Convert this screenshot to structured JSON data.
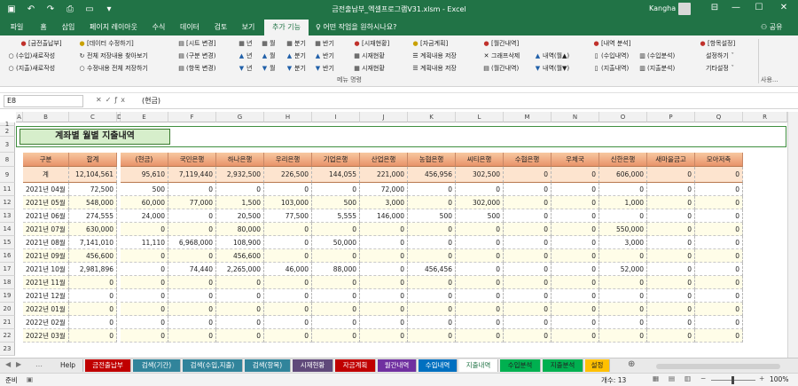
{
  "window": {
    "title": "금전출납부_엑셀프로그램V31.xlsm - Excel",
    "user": "Kangha",
    "qat_icons": [
      "save-icon",
      "undo-icon",
      "redo-icon",
      "print-icon",
      "screenshot-icon",
      "customize-icon"
    ]
  },
  "menu": {
    "tabs": [
      "파일",
      "홈",
      "삽입",
      "페이지 레이아웃",
      "수식",
      "데이터",
      "검토",
      "보기",
      "추가 기능"
    ],
    "active": "추가 기능",
    "tell_me": "어떤 작업을 원하시나요?",
    "share": "공유"
  },
  "ribbon": {
    "row1": [
      "[금전출납부]",
      "[데이터 수정하기]",
      "[시트 변경]",
      "년",
      "월",
      "분기",
      "반기",
      "[시재현황]",
      "[자금계획]",
      "[월간내역]",
      "[내역 분석]",
      "[항목설정]"
    ],
    "row2": [
      "(수입)새로작성",
      "전체 저장내용 찾아보기",
      "(구분 변경)",
      "년",
      "월",
      "분기",
      "반기",
      "시재현황",
      "계획내용 저장",
      "그래프삭제",
      "내역(월▲)",
      "(수입내역)",
      "(수입분석)",
      "설정하기"
    ],
    "row3": [
      "(지출)새로작성",
      "수정내용 전체 저장하기",
      "(항목 변경)",
      "년",
      "월",
      "분기",
      "반기",
      "시재현황",
      "계획내용 저장",
      "(월간내역)",
      "내역(월▼)",
      "(지출내역)",
      "(지출분석)",
      "기타설정"
    ],
    "group_label": "메뉴 명령",
    "group_label2": "사용..."
  },
  "formula": {
    "namebox": "E8",
    "icons": [
      "cancel-icon",
      "enter-icon",
      "fx-icon"
    ],
    "value": "(현금)"
  },
  "columns": [
    "A",
    "B",
    "C",
    "D",
    "E",
    "F",
    "G",
    "H",
    "I",
    "J",
    "K",
    "L",
    "M",
    "N",
    "O",
    "P",
    "Q",
    "R"
  ],
  "row_numbers": [
    "1",
    "2",
    "3",
    "8",
    "9",
    "11",
    "12",
    "13",
    "14",
    "15",
    "16",
    "17",
    "18",
    "19",
    "20",
    "21",
    "22",
    "23"
  ],
  "sheet_title": "계좌별 월별 지출내역",
  "table": {
    "headers": [
      "구분",
      "합계",
      "(현금)",
      "국민은행",
      "하나은행",
      "우리은행",
      "기업은행",
      "산업은행",
      "농협은행",
      "씨티은행",
      "수협은행",
      "우체국",
      "신한은행",
      "새마을금고",
      "모아저축"
    ],
    "total": [
      "계",
      "12,104,561",
      "95,610",
      "7,119,440",
      "2,932,500",
      "226,500",
      "144,055",
      "221,000",
      "456,956",
      "302,500",
      "0",
      "0",
      "606,000",
      "0",
      "0"
    ],
    "rows": [
      [
        "2021년 04월",
        "72,500",
        "500",
        "0",
        "0",
        "0",
        "0",
        "72,000",
        "0",
        "0",
        "0",
        "0",
        "0",
        "0",
        "0"
      ],
      [
        "2021년 05월",
        "548,000",
        "60,000",
        "77,000",
        "1,500",
        "103,000",
        "500",
        "3,000",
        "0",
        "302,000",
        "0",
        "0",
        "1,000",
        "0",
        "0"
      ],
      [
        "2021년 06월",
        "274,555",
        "24,000",
        "0",
        "20,500",
        "77,500",
        "5,555",
        "146,000",
        "500",
        "500",
        "0",
        "0",
        "0",
        "0",
        "0"
      ],
      [
        "2021년 07월",
        "630,000",
        "0",
        "0",
        "80,000",
        "0",
        "0",
        "0",
        "0",
        "0",
        "0",
        "0",
        "550,000",
        "0",
        "0"
      ],
      [
        "2021년 08월",
        "7,141,010",
        "11,110",
        "6,968,000",
        "108,900",
        "0",
        "50,000",
        "0",
        "0",
        "0",
        "0",
        "0",
        "3,000",
        "0",
        "0"
      ],
      [
        "2021년 09월",
        "456,600",
        "0",
        "0",
        "456,600",
        "0",
        "0",
        "0",
        "0",
        "0",
        "0",
        "0",
        "0",
        "0",
        "0"
      ],
      [
        "2021년 10월",
        "2,981,896",
        "0",
        "74,440",
        "2,265,000",
        "46,000",
        "88,000",
        "0",
        "456,456",
        "0",
        "0",
        "0",
        "52,000",
        "0",
        "0"
      ],
      [
        "2021년 11월",
        "0",
        "0",
        "0",
        "0",
        "0",
        "0",
        "0",
        "0",
        "0",
        "0",
        "0",
        "0",
        "0",
        "0"
      ],
      [
        "2021년 12월",
        "0",
        "0",
        "0",
        "0",
        "0",
        "0",
        "0",
        "0",
        "0",
        "0",
        "0",
        "0",
        "0",
        "0"
      ],
      [
        "2022년 01월",
        "0",
        "0",
        "0",
        "0",
        "0",
        "0",
        "0",
        "0",
        "0",
        "0",
        "0",
        "0",
        "0",
        "0"
      ],
      [
        "2022년 02월",
        "0",
        "0",
        "0",
        "0",
        "0",
        "0",
        "0",
        "0",
        "0",
        "0",
        "0",
        "0",
        "0",
        "0"
      ],
      [
        "2022년 03월",
        "0",
        "0",
        "0",
        "0",
        "0",
        "0",
        "0",
        "0",
        "0",
        "0",
        "0",
        "0",
        "0",
        "0"
      ]
    ]
  },
  "sheet_tabs": [
    {
      "label": "Help",
      "color": "#e9e9e9",
      "text": "#222"
    },
    {
      "label": "금전출납부",
      "color": "#c00000",
      "text": "#fff"
    },
    {
      "label": "검색(기간)",
      "color": "#31849b",
      "text": "#fff"
    },
    {
      "label": "검색(수입,지출)",
      "color": "#31849b",
      "text": "#fff"
    },
    {
      "label": "검색(항목)",
      "color": "#31849b",
      "text": "#fff"
    },
    {
      "label": "시재현황",
      "color": "#60497a",
      "text": "#fff"
    },
    {
      "label": "자금계획",
      "color": "#c00000",
      "text": "#fff"
    },
    {
      "label": "월간내역",
      "color": "#7030a0",
      "text": "#fff"
    },
    {
      "label": "수입내역",
      "color": "#0070c0",
      "text": "#fff"
    },
    {
      "label": "지출내역",
      "color": "#ffffff",
      "text": "#217346"
    },
    {
      "label": "수입분석",
      "color": "#00b050",
      "text": "#222"
    },
    {
      "label": "지출분석",
      "color": "#00b050",
      "text": "#222"
    },
    {
      "label": "설정",
      "color": "#ffc000",
      "text": "#222"
    }
  ],
  "status": {
    "ready": "준비",
    "count": "개수: 13",
    "zoom": "100%"
  }
}
